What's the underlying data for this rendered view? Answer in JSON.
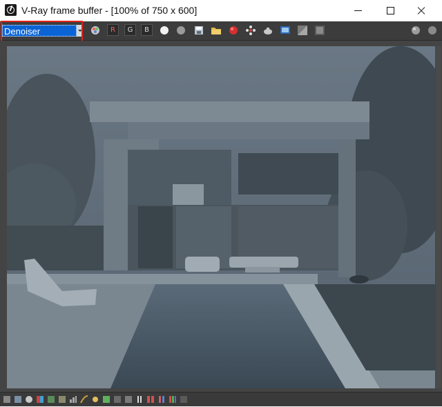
{
  "window": {
    "title": "V-Ray frame buffer - [100% of 750 x 600]",
    "app_icon": "vray-icon",
    "controls": [
      "minimize-icon",
      "maximize-icon",
      "close-icon"
    ]
  },
  "toolbar": {
    "channel_select": {
      "value": "Denoiser",
      "highlight_color": "#e2231a"
    },
    "buttons": [
      {
        "name": "show-correction-icon"
      },
      {
        "name": "channel-red-button",
        "label": "R"
      },
      {
        "name": "channel-green-button",
        "label": "G"
      },
      {
        "name": "channel-blue-button",
        "label": "B"
      },
      {
        "name": "white-circle-icon"
      },
      {
        "name": "gray-circle-icon"
      },
      {
        "name": "save-image-icon"
      },
      {
        "name": "open-folder-icon"
      },
      {
        "name": "stop-render-icon"
      },
      {
        "name": "region-render-icon"
      },
      {
        "name": "teapot-render-icon"
      },
      {
        "name": "monitor-icon"
      },
      {
        "name": "compare-icon"
      },
      {
        "name": "history-icon"
      },
      {
        "name": "gray-sphere-icon"
      },
      {
        "name": "settings-icon"
      }
    ]
  },
  "render": {
    "description_colors": {
      "sky": "#5e6c78",
      "house": "#6e7b85",
      "pool": "#3e4d5a"
    }
  },
  "statusbar": {
    "icons": [
      "zoom-icon",
      "track-mouse-icon",
      "record-icon",
      "color-clamp-icon",
      "lens-effects-icon",
      "lut-icon",
      "levels-icon",
      "curve-icon",
      "exposure-icon",
      "white-balance-icon",
      "hue-icon",
      "contrast-icon",
      "stamp-icon",
      "compare-icon",
      "pixel-aspect-icon",
      "info-icon",
      "settings-icon"
    ]
  }
}
